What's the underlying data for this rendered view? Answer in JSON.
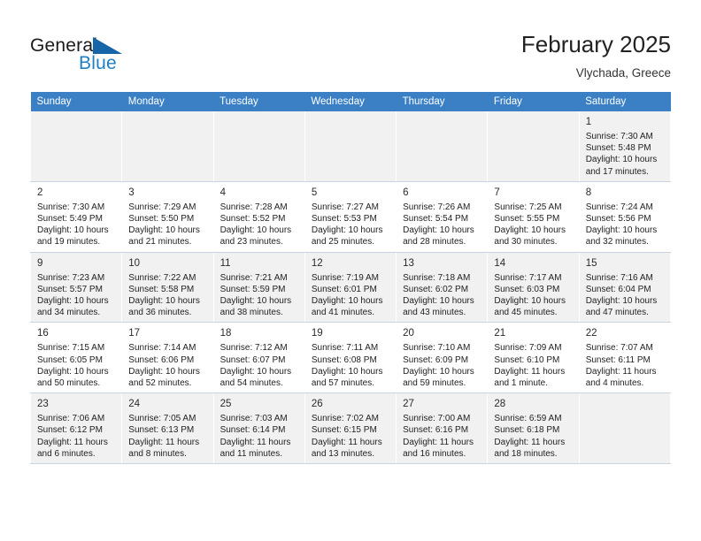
{
  "brand": {
    "name_part1": "General",
    "name_part2": "Blue",
    "triangle_color": "#1565a8",
    "blue_color": "#1f7fc4"
  },
  "header": {
    "month_title": "February 2025",
    "location": "Vlychada, Greece"
  },
  "theme": {
    "header_row_bg": "#3b80c4",
    "shaded_row_bg": "#f1f1f1",
    "grid_line": "#c8d4e0"
  },
  "weekdays": [
    "Sunday",
    "Monday",
    "Tuesday",
    "Wednesday",
    "Thursday",
    "Friday",
    "Saturday"
  ],
  "weeks": [
    [
      {
        "day": "",
        "sunrise": "",
        "sunset": "",
        "daylight": ""
      },
      {
        "day": "",
        "sunrise": "",
        "sunset": "",
        "daylight": ""
      },
      {
        "day": "",
        "sunrise": "",
        "sunset": "",
        "daylight": ""
      },
      {
        "day": "",
        "sunrise": "",
        "sunset": "",
        "daylight": ""
      },
      {
        "day": "",
        "sunrise": "",
        "sunset": "",
        "daylight": ""
      },
      {
        "day": "",
        "sunrise": "",
        "sunset": "",
        "daylight": ""
      },
      {
        "day": "1",
        "sunrise": "Sunrise: 7:30 AM",
        "sunset": "Sunset: 5:48 PM",
        "daylight": "Daylight: 10 hours and 17 minutes."
      }
    ],
    [
      {
        "day": "2",
        "sunrise": "Sunrise: 7:30 AM",
        "sunset": "Sunset: 5:49 PM",
        "daylight": "Daylight: 10 hours and 19 minutes."
      },
      {
        "day": "3",
        "sunrise": "Sunrise: 7:29 AM",
        "sunset": "Sunset: 5:50 PM",
        "daylight": "Daylight: 10 hours and 21 minutes."
      },
      {
        "day": "4",
        "sunrise": "Sunrise: 7:28 AM",
        "sunset": "Sunset: 5:52 PM",
        "daylight": "Daylight: 10 hours and 23 minutes."
      },
      {
        "day": "5",
        "sunrise": "Sunrise: 7:27 AM",
        "sunset": "Sunset: 5:53 PM",
        "daylight": "Daylight: 10 hours and 25 minutes."
      },
      {
        "day": "6",
        "sunrise": "Sunrise: 7:26 AM",
        "sunset": "Sunset: 5:54 PM",
        "daylight": "Daylight: 10 hours and 28 minutes."
      },
      {
        "day": "7",
        "sunrise": "Sunrise: 7:25 AM",
        "sunset": "Sunset: 5:55 PM",
        "daylight": "Daylight: 10 hours and 30 minutes."
      },
      {
        "day": "8",
        "sunrise": "Sunrise: 7:24 AM",
        "sunset": "Sunset: 5:56 PM",
        "daylight": "Daylight: 10 hours and 32 minutes."
      }
    ],
    [
      {
        "day": "9",
        "sunrise": "Sunrise: 7:23 AM",
        "sunset": "Sunset: 5:57 PM",
        "daylight": "Daylight: 10 hours and 34 minutes."
      },
      {
        "day": "10",
        "sunrise": "Sunrise: 7:22 AM",
        "sunset": "Sunset: 5:58 PM",
        "daylight": "Daylight: 10 hours and 36 minutes."
      },
      {
        "day": "11",
        "sunrise": "Sunrise: 7:21 AM",
        "sunset": "Sunset: 5:59 PM",
        "daylight": "Daylight: 10 hours and 38 minutes."
      },
      {
        "day": "12",
        "sunrise": "Sunrise: 7:19 AM",
        "sunset": "Sunset: 6:01 PM",
        "daylight": "Daylight: 10 hours and 41 minutes."
      },
      {
        "day": "13",
        "sunrise": "Sunrise: 7:18 AM",
        "sunset": "Sunset: 6:02 PM",
        "daylight": "Daylight: 10 hours and 43 minutes."
      },
      {
        "day": "14",
        "sunrise": "Sunrise: 7:17 AM",
        "sunset": "Sunset: 6:03 PM",
        "daylight": "Daylight: 10 hours and 45 minutes."
      },
      {
        "day": "15",
        "sunrise": "Sunrise: 7:16 AM",
        "sunset": "Sunset: 6:04 PM",
        "daylight": "Daylight: 10 hours and 47 minutes."
      }
    ],
    [
      {
        "day": "16",
        "sunrise": "Sunrise: 7:15 AM",
        "sunset": "Sunset: 6:05 PM",
        "daylight": "Daylight: 10 hours and 50 minutes."
      },
      {
        "day": "17",
        "sunrise": "Sunrise: 7:14 AM",
        "sunset": "Sunset: 6:06 PM",
        "daylight": "Daylight: 10 hours and 52 minutes."
      },
      {
        "day": "18",
        "sunrise": "Sunrise: 7:12 AM",
        "sunset": "Sunset: 6:07 PM",
        "daylight": "Daylight: 10 hours and 54 minutes."
      },
      {
        "day": "19",
        "sunrise": "Sunrise: 7:11 AM",
        "sunset": "Sunset: 6:08 PM",
        "daylight": "Daylight: 10 hours and 57 minutes."
      },
      {
        "day": "20",
        "sunrise": "Sunrise: 7:10 AM",
        "sunset": "Sunset: 6:09 PM",
        "daylight": "Daylight: 10 hours and 59 minutes."
      },
      {
        "day": "21",
        "sunrise": "Sunrise: 7:09 AM",
        "sunset": "Sunset: 6:10 PM",
        "daylight": "Daylight: 11 hours and 1 minute."
      },
      {
        "day": "22",
        "sunrise": "Sunrise: 7:07 AM",
        "sunset": "Sunset: 6:11 PM",
        "daylight": "Daylight: 11 hours and 4 minutes."
      }
    ],
    [
      {
        "day": "23",
        "sunrise": "Sunrise: 7:06 AM",
        "sunset": "Sunset: 6:12 PM",
        "daylight": "Daylight: 11 hours and 6 minutes."
      },
      {
        "day": "24",
        "sunrise": "Sunrise: 7:05 AM",
        "sunset": "Sunset: 6:13 PM",
        "daylight": "Daylight: 11 hours and 8 minutes."
      },
      {
        "day": "25",
        "sunrise": "Sunrise: 7:03 AM",
        "sunset": "Sunset: 6:14 PM",
        "daylight": "Daylight: 11 hours and 11 minutes."
      },
      {
        "day": "26",
        "sunrise": "Sunrise: 7:02 AM",
        "sunset": "Sunset: 6:15 PM",
        "daylight": "Daylight: 11 hours and 13 minutes."
      },
      {
        "day": "27",
        "sunrise": "Sunrise: 7:00 AM",
        "sunset": "Sunset: 6:16 PM",
        "daylight": "Daylight: 11 hours and 16 minutes."
      },
      {
        "day": "28",
        "sunrise": "Sunrise: 6:59 AM",
        "sunset": "Sunset: 6:18 PM",
        "daylight": "Daylight: 11 hours and 18 minutes."
      },
      {
        "day": "",
        "sunrise": "",
        "sunset": "",
        "daylight": ""
      }
    ]
  ]
}
